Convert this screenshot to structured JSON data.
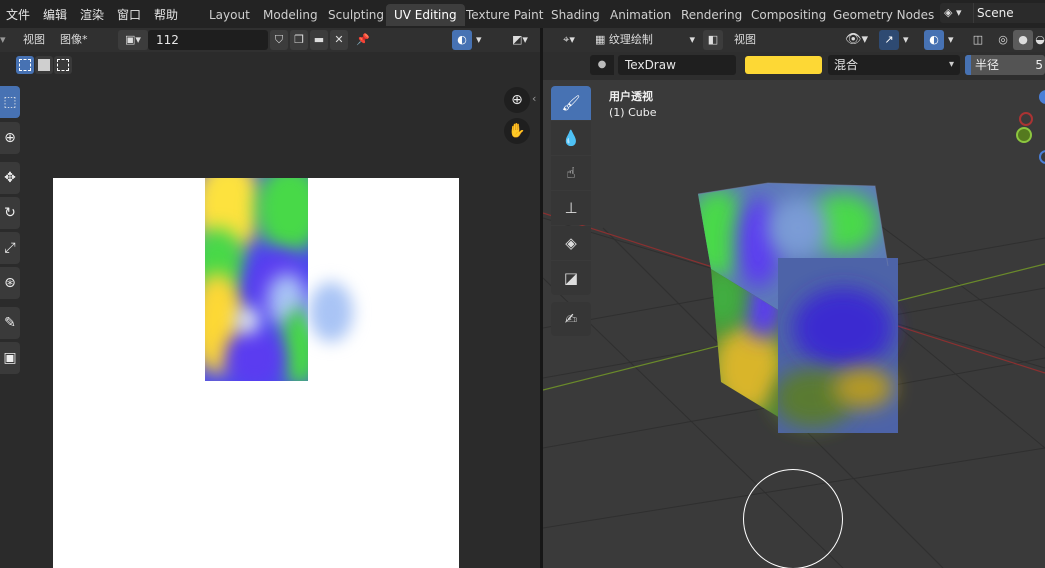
{
  "menu": [
    "文件",
    "编辑",
    "渲染",
    "窗口",
    "帮助"
  ],
  "workspaces": [
    "Layout",
    "Modeling",
    "Sculpting",
    "UV Editing",
    "Texture Paint",
    "Shading",
    "Animation",
    "Rendering",
    "Compositing",
    "Geometry Nodes"
  ],
  "active_workspace": "UV Editing",
  "scene": {
    "name": "Scene"
  },
  "uv_editor": {
    "view_menu": "视图",
    "image_menu": "图像*",
    "image_name": "112"
  },
  "viewport": {
    "mode": "纹理绘制",
    "view_menu": "视图",
    "brush_name": "TexDraw",
    "brush_color": "#fdd835",
    "blend_mode": "混合",
    "radius_label": "半径",
    "radius_value": "5",
    "perspective_label": "用户透视",
    "object_label": "(1) Cube"
  },
  "colors": {
    "accent": "#4772b3",
    "paint_yellow": "#fdd835",
    "paint_green": "#4cd94c",
    "paint_purple": "#5b3cf0",
    "paint_blue": "#a9c4f5"
  }
}
